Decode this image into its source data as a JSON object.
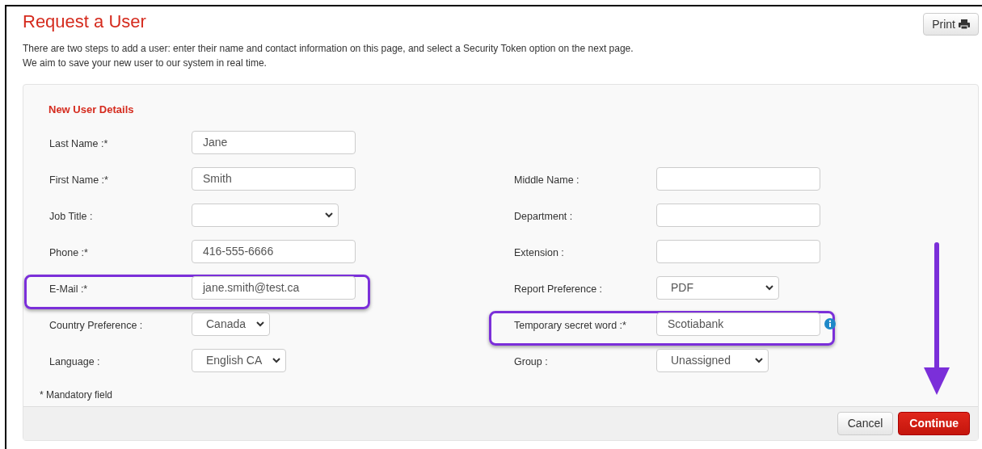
{
  "page": {
    "title": "Request a User",
    "intro_lines": [
      "There are two steps to add a user: enter their name and contact information on this page, and select a Security Token option on the next page.",
      "We aim to save your new user to our system in real time."
    ]
  },
  "print_button": {
    "label": "Print"
  },
  "panel": {
    "heading": "New User Details",
    "rows": [
      {
        "left": {
          "label": "Last Name :*",
          "kind": "text",
          "value": "Jane",
          "highlighted": false
        }
      },
      {
        "left": {
          "label": "First Name :*",
          "kind": "text",
          "value": "Smith",
          "highlighted": false
        },
        "right": {
          "label": "Middle Name :",
          "kind": "text",
          "highlighted": false
        }
      },
      {
        "left": {
          "label": "Job Title :",
          "kind": "select",
          "highlighted": false
        },
        "right": {
          "label": "Department :",
          "kind": "text",
          "highlighted": false
        }
      },
      {
        "left": {
          "label": "Phone :*",
          "kind": "text",
          "value": "416-555-6666",
          "highlighted": false
        },
        "right": {
          "label": "Extension :",
          "kind": "text",
          "highlighted": false
        }
      },
      {
        "left": {
          "label": "E-Mail :*",
          "kind": "text",
          "value": "jane.smith@test.ca",
          "highlighted": true
        },
        "right": {
          "label": "Report Preference :",
          "kind": "select",
          "value": "PDF",
          "highlighted": false
        }
      },
      {
        "left": {
          "label": "Country Preference :",
          "kind": "select",
          "value": "Canada",
          "highlighted": false
        },
        "right": {
          "label": "Temporary secret word :*",
          "kind": "text",
          "value": "Scotiabank",
          "highlighted": true,
          "has_info": true
        }
      },
      {
        "left": {
          "label": "Language :",
          "kind": "select",
          "value": "English CA",
          "highlighted": false
        },
        "right": {
          "label": "Group :",
          "kind": "select",
          "value": "Unassigned",
          "highlighted": false
        }
      }
    ],
    "footnote": "* Mandatory field"
  },
  "footer": {
    "buttons": [
      {
        "label": "Cancel",
        "kind": "secondary"
      },
      {
        "label": "Continue",
        "kind": "primary"
      }
    ]
  }
}
